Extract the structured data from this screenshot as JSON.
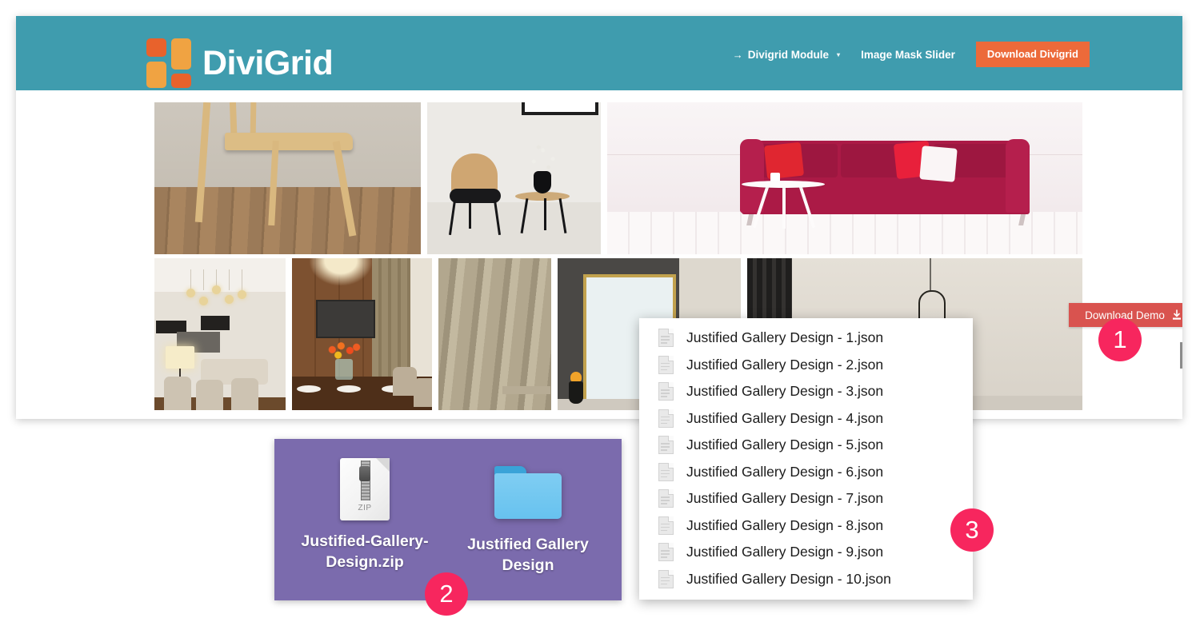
{
  "site": {
    "brand": "DiviGrid",
    "logo_colors": [
      "#e8622c",
      "#f0a342",
      "#f0a342",
      "#e8622c"
    ],
    "header_color": "#3f9cae",
    "nav": {
      "items": [
        {
          "arrow": "→",
          "label": "Divigrid Module",
          "caret": "▾"
        },
        {
          "label": "Image Mask Slider"
        }
      ],
      "cta_label": "Download Divigrid",
      "cta_color": "#ec6a3a"
    }
  },
  "floating": {
    "download_demo_label": "Download Demo",
    "download_demo_color": "#d9534f",
    "scroll_top_icon": "chevron-up-icon"
  },
  "file_list": {
    "files": [
      {
        "name": "Justified Gallery Design - 1.json"
      },
      {
        "name": "Justified Gallery Design - 2.json"
      },
      {
        "name": "Justified Gallery Design - 3.json"
      },
      {
        "name": "Justified Gallery Design - 4.json"
      },
      {
        "name": "Justified Gallery Design - 5.json"
      },
      {
        "name": "Justified Gallery Design - 6.json"
      },
      {
        "name": "Justified Gallery Design - 7.json"
      },
      {
        "name": "Justified Gallery Design - 8.json"
      },
      {
        "name": "Justified Gallery Design - 9.json"
      },
      {
        "name": "Justified Gallery Design - 10.json"
      }
    ]
  },
  "finder": {
    "panel_color": "#7b6bad",
    "items": [
      {
        "type": "zip",
        "label": "Justified-Gallery-Design.zip",
        "badge_text": "ZIP"
      },
      {
        "type": "folder",
        "label": "Justified Gallery Design"
      }
    ]
  },
  "badges": {
    "color": "#f7265e",
    "items": [
      {
        "number": "1"
      },
      {
        "number": "2"
      },
      {
        "number": "3"
      }
    ]
  },
  "gallery": {
    "images": [
      {
        "alt": "wooden-chair-on-floor"
      },
      {
        "alt": "chair-with-side-table-and-vase"
      },
      {
        "alt": "crimson-sofa-with-pillows"
      },
      {
        "alt": "living-room-pendant-lights"
      },
      {
        "alt": "dining-room-tv-wood-panel"
      },
      {
        "alt": "curtains-window"
      },
      {
        "alt": "mirror-gold-frame"
      },
      {
        "alt": "pendant-lamp-minimal"
      }
    ]
  }
}
